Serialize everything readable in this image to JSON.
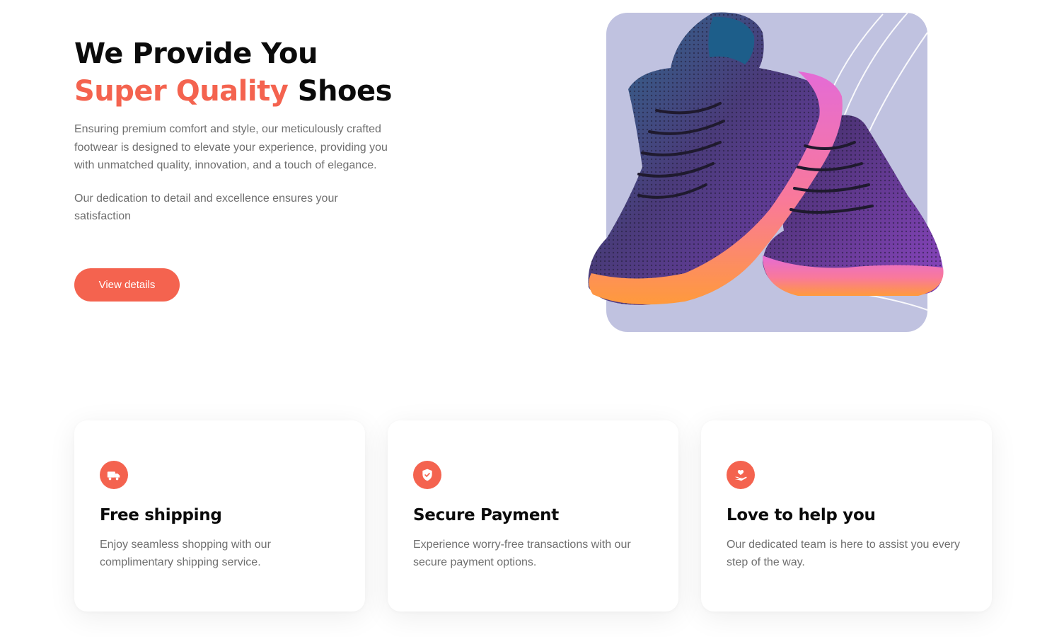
{
  "hero": {
    "title_part1": "We Provide You ",
    "title_accent": "Super Quality",
    "title_part2": " Shoes",
    "description": "Ensuring premium comfort and style, our meticulously crafted footwear is designed to elevate your experience, providing you with unmatched quality, innovation, and a touch of elegance.",
    "description2": "Our dedication to detail and excellence ensures your satisfaction",
    "cta_label": "View details"
  },
  "features": [
    {
      "icon": "truck-icon",
      "title": "Free shipping",
      "description": "Enjoy seamless shopping with our complimentary shipping service."
    },
    {
      "icon": "shield-icon",
      "title": "Secure Payment",
      "description": "Experience worry-free transactions with our secure payment options."
    },
    {
      "icon": "heart-hand-icon",
      "title": "Love to help you",
      "description": "Our dedicated team is here to assist you every step of the way."
    }
  ],
  "colors": {
    "accent": "#f4634f",
    "image_bg": "#c0c2e0",
    "text_muted": "#6f6f6f"
  }
}
